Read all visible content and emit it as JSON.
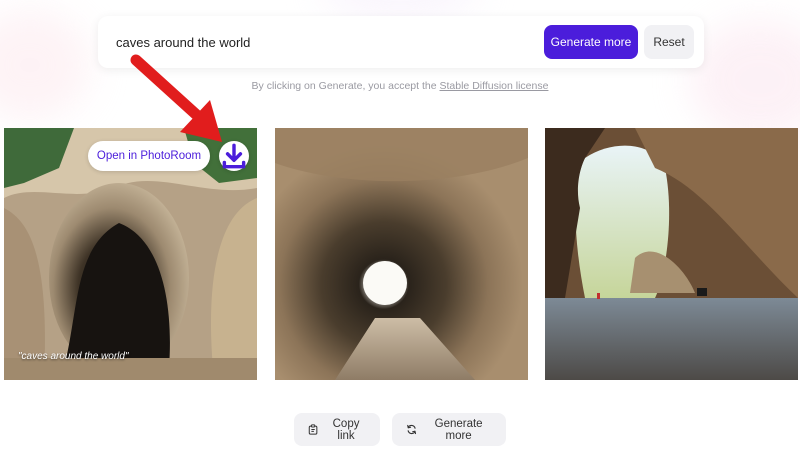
{
  "search": {
    "query": "caves around the world",
    "generate_label": "Generate more",
    "reset_label": "Reset"
  },
  "license": {
    "prefix": "By clicking on Generate, you accept the ",
    "link": "Stable Diffusion license"
  },
  "gallery": {
    "images": [
      {
        "open_label": "Open in PhotoRoom",
        "download_icon": "download-icon",
        "caption": "\"caves around the world\""
      },
      {},
      {}
    ]
  },
  "actions": {
    "copy_label": "Copy link",
    "copy_icon": "clipboard-icon",
    "more_label": "Generate more",
    "more_icon": "refresh-icon"
  },
  "colors": {
    "accent": "#4b1ddb",
    "arrow": "#e11d1d"
  }
}
